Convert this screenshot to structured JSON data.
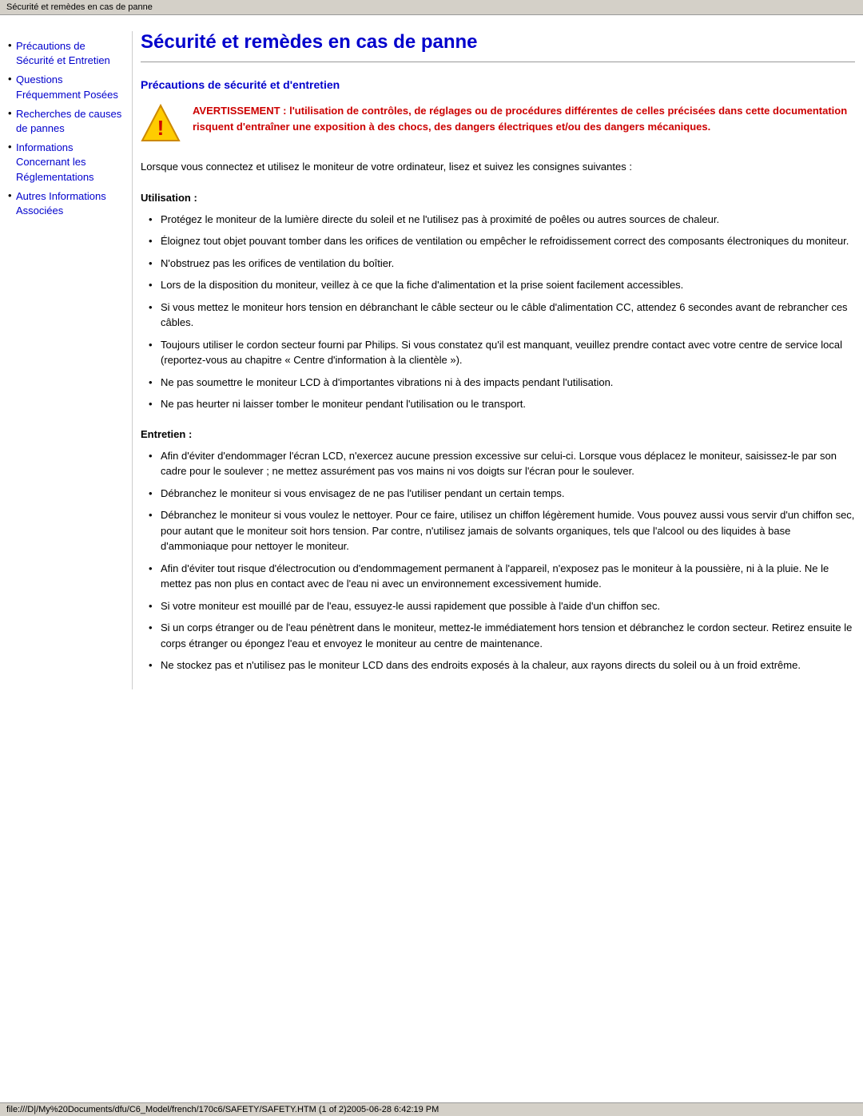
{
  "title_bar": {
    "text": "Sécurité et remèdes en cas de panne"
  },
  "sidebar": {
    "links": [
      {
        "id": "precautions",
        "text": "Précautions de Sécurité et Entretien",
        "href": "#precautions"
      },
      {
        "id": "questions",
        "text": "Questions Fréquemment Posées",
        "href": "#questions"
      },
      {
        "id": "recherches",
        "text": "Recherches de causes de pannes",
        "href": "#recherches"
      },
      {
        "id": "informations-reglementations",
        "text": "Informations Concernant les Réglementations",
        "href": "#reglementations"
      },
      {
        "id": "autres-informations",
        "text": "Autres Informations Associées",
        "href": "#autres"
      }
    ]
  },
  "page_title": "Sécurité et remèdes en cas de panne",
  "section_precautions": {
    "title": "Précautions de sécurité et d'entretien",
    "warning": "AVERTISSEMENT : l'utilisation de contrôles, de réglages ou de procédures différentes de celles précisées dans cette documentation risquent d'entraîner une exposition à des chocs, des dangers électriques et/ou des dangers mécaniques.",
    "intro": "Lorsque vous connectez et utilisez le moniteur de votre ordinateur, lisez et suivez les consignes suivantes :"
  },
  "utilisation": {
    "title": "Utilisation :",
    "items": [
      "Protégez le moniteur de la lumière directe du soleil et ne l'utilisez pas à proximité de poêles ou autres sources de chaleur.",
      "Éloignez tout objet pouvant tomber dans les orifices de ventilation ou empêcher le refroidissement correct des composants électroniques du moniteur.",
      "N'obstruez pas les orifices de ventilation du boîtier.",
      "Lors de la disposition du moniteur, veillez à ce que la fiche d'alimentation et la prise soient facilement accessibles.",
      "Si vous mettez le moniteur hors tension en débranchant le câble secteur ou le câble d'alimentation CC, attendez 6 secondes avant de rebrancher ces câbles.",
      "Toujours utiliser le cordon secteur fourni par Philips. Si vous constatez qu'il est manquant, veuillez prendre contact avec votre centre de service local (reportez-vous au chapitre « Centre d'information à la clientèle »).",
      "Ne pas soumettre le moniteur LCD à d'importantes vibrations ni à des impacts pendant l'utilisation.",
      "Ne pas heurter ni laisser tomber le moniteur pendant l'utilisation ou le transport."
    ]
  },
  "entretien": {
    "title": "Entretien :",
    "items": [
      "Afin d'éviter d'endommager l'écran LCD, n'exercez aucune pression excessive sur celui-ci. Lorsque vous déplacez le moniteur, saisissez-le par son cadre pour le soulever ; ne mettez assurément pas vos mains ni vos doigts sur l'écran pour le soulever.",
      "Débranchez le moniteur si vous envisagez de ne pas l'utiliser pendant un certain temps.",
      "Débranchez le moniteur si vous voulez le nettoyer. Pour ce faire, utilisez un chiffon légèrement humide. Vous pouvez aussi vous servir d'un chiffon sec, pour autant que le moniteur soit hors tension. Par contre, n'utilisez jamais de solvants organiques, tels que l'alcool ou des liquides à base d'ammoniaque pour nettoyer le moniteur.",
      "Afin d'éviter tout risque d'électrocution ou d'endommagement permanent à l'appareil, n'exposez pas le moniteur à la poussière, ni à la pluie. Ne le mettez pas non plus en contact avec de l'eau ni avec un environnement excessivement humide.",
      "Si votre moniteur est mouillé par de l'eau, essuyez-le aussi rapidement que possible à l'aide d'un chiffon sec.",
      "Si un corps étranger ou de l'eau pénètrent dans le moniteur, mettez-le immédiatement hors tension et débranchez le cordon secteur. Retirez ensuite le corps étranger ou épongez l'eau et envoyez le moniteur au centre de maintenance.",
      "Ne stockez pas et n'utilisez pas le moniteur LCD dans des endroits exposés à la chaleur, aux rayons directs du soleil ou à un froid extrême."
    ]
  },
  "status_bar": {
    "text": "file:///D|/My%20Documents/dfu/C6_Model/french/170c6/SAFETY/SAFETY.HTM (1 of 2)2005-06-28 6:42:19 PM"
  }
}
